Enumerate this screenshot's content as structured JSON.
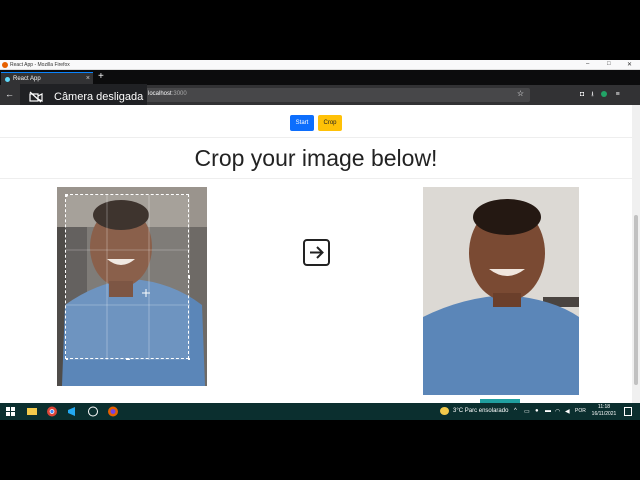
{
  "window": {
    "title": "React App - Mozilla Firefox",
    "controls": {
      "minimize": "–",
      "maximize": "□",
      "close": "✕"
    }
  },
  "tabs": [
    {
      "label": "React App",
      "close": "×"
    }
  ],
  "new_tab": "+",
  "navbar": {
    "back": "←",
    "url_host": "localhost",
    "url_port": ":3000",
    "star": "☆"
  },
  "overlay": {
    "camera_status": "Câmera desligada",
    "icon": "camera-off-icon"
  },
  "page": {
    "start_label": "Start",
    "crop_label": "Crop",
    "heading": "Crop your image below!",
    "arrow_icon": "arrow-right-icon"
  },
  "colors": {
    "start": "#0d6efd",
    "crop": "#ffc107",
    "taskbar": "#0b2f2f"
  },
  "taskbar": {
    "weather": "3°C  Parc ensolarado",
    "language": "POR",
    "time": "11:18",
    "date": "16/11/2021",
    "apps": [
      "windows-start-icon",
      "file-explorer-icon",
      "chrome-icon",
      "vscode-icon",
      "obs-icon",
      "firefox-icon"
    ]
  }
}
